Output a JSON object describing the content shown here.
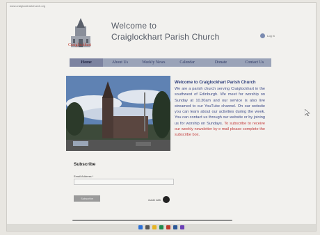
{
  "browser": {
    "url": "www.craiglockhartchurch.org"
  },
  "site": {
    "logo_text": "Craiglockhart",
    "title_line1": "Welcome to",
    "title_line2": "Craiglockhart Parish Church",
    "login_label": "Log in"
  },
  "nav": {
    "items": [
      "Home",
      "About Us",
      "Weekly News",
      "Calendar",
      "Donate",
      "Contact Us"
    ],
    "active": "Home"
  },
  "content": {
    "heading": "Welcome to Craiglockhart Parish Church",
    "paragraph": "We are a parish church serving Craiglockhart in the southwest of Edinburgh. We meet for worship on Sunday at 10.30am and our service is also live streamed to our YouTube channel. On our website you can learn about our activities during the week. You can contact us through our website or by joining us for worship on Sundays.",
    "paragraph_red": "To subscribe to receive our weekly newsletter by e mail please complete the subscribe box."
  },
  "subscribe": {
    "title": "Subscribe",
    "email_label": "Email Address *",
    "email_value": "",
    "button_label": "Subscribe",
    "made_with": "made with"
  },
  "colors": {
    "nav_bg": "#9aa3b8",
    "text_blue": "#3e4c8a",
    "text_red": "#c23a3a"
  }
}
